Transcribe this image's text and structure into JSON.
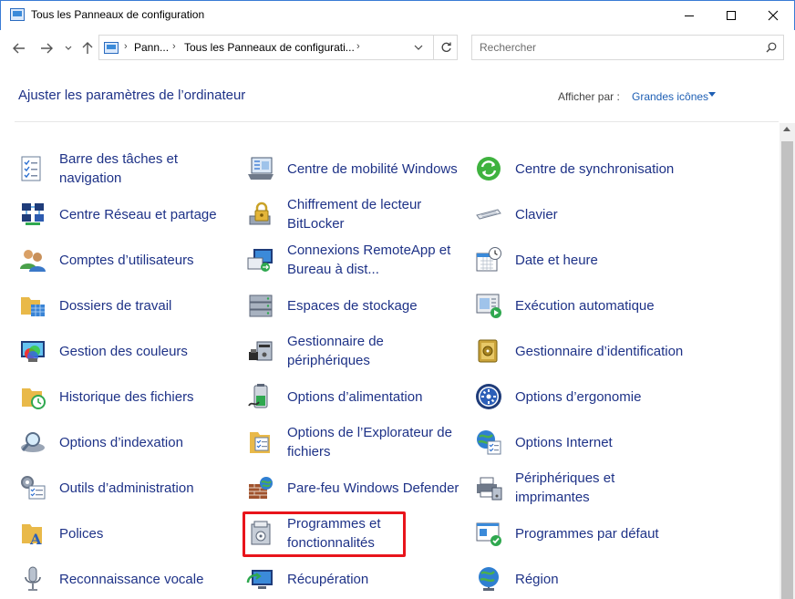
{
  "window": {
    "title": "Tous les Panneaux de configuration"
  },
  "address": {
    "crumbs": [
      "Pann...",
      "Tous les Panneaux de configurati..."
    ]
  },
  "search": {
    "placeholder": "Rechercher"
  },
  "header": {
    "title": "Ajuster les paramètres de l’ordinateur",
    "view_by_label": "Afficher par :",
    "view_by_value": "Grandes icônes"
  },
  "items": {
    "col1": [
      "Barre des tâches et navigation",
      "Centre Réseau et partage",
      "Comptes d’utilisateurs",
      "Dossiers de travail",
      "Gestion des couleurs",
      "Historique des fichiers",
      "Options d’indexation",
      "Outils d’administration",
      "Polices",
      "Reconnaissance vocale"
    ],
    "col2": [
      "Centre de mobilité Windows",
      "Chiffrement de lecteur BitLocker",
      "Connexions RemoteApp et Bureau à dist...",
      "Espaces de stockage",
      "Gestionnaire de périphériques",
      "Options d’alimentation",
      "Options de l’Explorateur de fichiers",
      "Pare-feu Windows Defender",
      "Programmes et fonctionnalités",
      "Récupération"
    ],
    "col3": [
      "Centre de synchronisation",
      "Clavier",
      "Date et heure",
      "Exécution automatique",
      "Gestionnaire d’identification",
      "Options d’ergonomie",
      "Options Internet",
      "Périphériques et imprimantes",
      "Programmes par défaut",
      "Région"
    ]
  },
  "colors": {
    "link": "#1e3287",
    "highlight": "#e8141b"
  }
}
